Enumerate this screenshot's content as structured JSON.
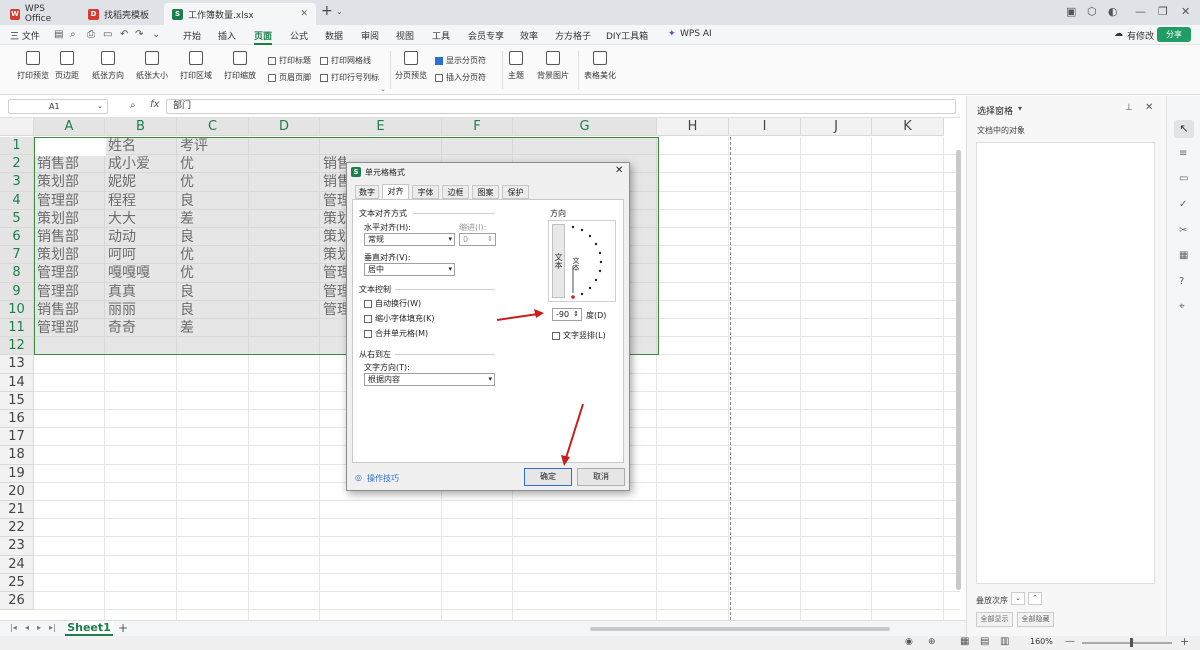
{
  "tabs": [
    {
      "label": "WPS Office",
      "color": "#d63b2f",
      "glyph": "W"
    },
    {
      "label": "找稻壳模板",
      "color": "#d63b2f",
      "glyph": "D"
    },
    {
      "label": "工作簿数量.xlsx",
      "color": "#1a7f4a",
      "glyph": "S"
    }
  ],
  "tab_plus": "+",
  "menu": {
    "file": "三 文件",
    "items": [
      "开始",
      "插入",
      "页面",
      "公式",
      "数据",
      "审阅",
      "视图",
      "工具",
      "会员专享",
      "效率",
      "方方格子",
      "DIY工具箱"
    ],
    "active": "页面",
    "ai": "WPS AI",
    "changes": "有修改",
    "share": "分享"
  },
  "ribbon": {
    "big": [
      "打印预览",
      "页边距",
      "纸张方向",
      "纸张大小",
      "打印区域",
      "打印缩放"
    ],
    "small1": [
      "打印标题",
      "页眉页脚"
    ],
    "checks": [
      {
        "label": "打印网格线",
        "checked": false
      },
      {
        "label": "打印行号列标",
        "checked": false
      }
    ],
    "pagebreak_preview": "分页预览",
    "show_pagebreak": "显示分页符",
    "insert_pagebreak": "插入分页符",
    "theme": "主题",
    "bg": "背景图片",
    "beautify": "表格美化"
  },
  "formula": {
    "cellref": "A1",
    "fx": "fx",
    "value": "部门"
  },
  "columns": [
    "A",
    "B",
    "C",
    "D",
    "E",
    "F",
    "G",
    "H",
    "I",
    "J",
    "K"
  ],
  "rows": [
    "1",
    "2",
    "3",
    "4",
    "5",
    "6",
    "7",
    "8",
    "9",
    "10",
    "11",
    "12",
    "13",
    "14",
    "15",
    "16",
    "17",
    "18",
    "19",
    "20",
    "21",
    "22",
    "23",
    "24",
    "25",
    "26"
  ],
  "cells": {
    "A": [
      "部门",
      "销售部",
      "策划部",
      "管理部",
      "策划部",
      "销售部",
      "策划部",
      "管理部",
      "管理部",
      "销售部",
      "管理部"
    ],
    "B": [
      "姓名",
      "成小爱",
      "妮妮",
      "程程",
      "大大",
      "动动",
      "呵呵",
      "嘎嘎嘎",
      "真真",
      "丽丽",
      "奇奇"
    ],
    "C": [
      "考评",
      "优",
      "优",
      "良",
      "差",
      "良",
      "优",
      "优",
      "良",
      "良",
      "差"
    ],
    "E": [
      "",
      "销售部",
      "销售",
      "管理",
      "策划",
      "策划",
      "策划",
      "管理",
      "管理",
      "管理",
      ""
    ]
  },
  "sheet": {
    "name": "Sheet1",
    "add": "+"
  },
  "pane": {
    "title": "选择窗格",
    "subtitle": "文档中的对象",
    "order": "叠放次序",
    "show_all": "全部显示",
    "hide_all": "全部隐藏"
  },
  "zoom": "160%",
  "dialog": {
    "title": "单元格格式",
    "tabs": [
      "数字",
      "对齐",
      "字体",
      "边框",
      "图案",
      "保护"
    ],
    "active_tab": "对齐",
    "align_section": "文本对齐方式",
    "h_label": "水平对齐(H):",
    "h_value": "常规",
    "indent_label": "缩进(I):",
    "indent_value": "0",
    "v_label": "垂直对齐(V):",
    "v_value": "居中",
    "control_section": "文本控制",
    "wrap": "自动换行(W)",
    "shrink": "缩小字体填充(K)",
    "merge": "合并单元格(M)",
    "rtl_section": "从右到左",
    "dir_label": "文字方向(T):",
    "dir_value": "根据内容",
    "orient_section": "方向",
    "orient_vert_text": "文本",
    "orient_dial_text": "文本",
    "degree_value": "-90",
    "degree_label": "度(D)",
    "vertical_text": "文字竖排(L)",
    "tips": "操作技巧",
    "ok": "确定",
    "cancel": "取消"
  }
}
